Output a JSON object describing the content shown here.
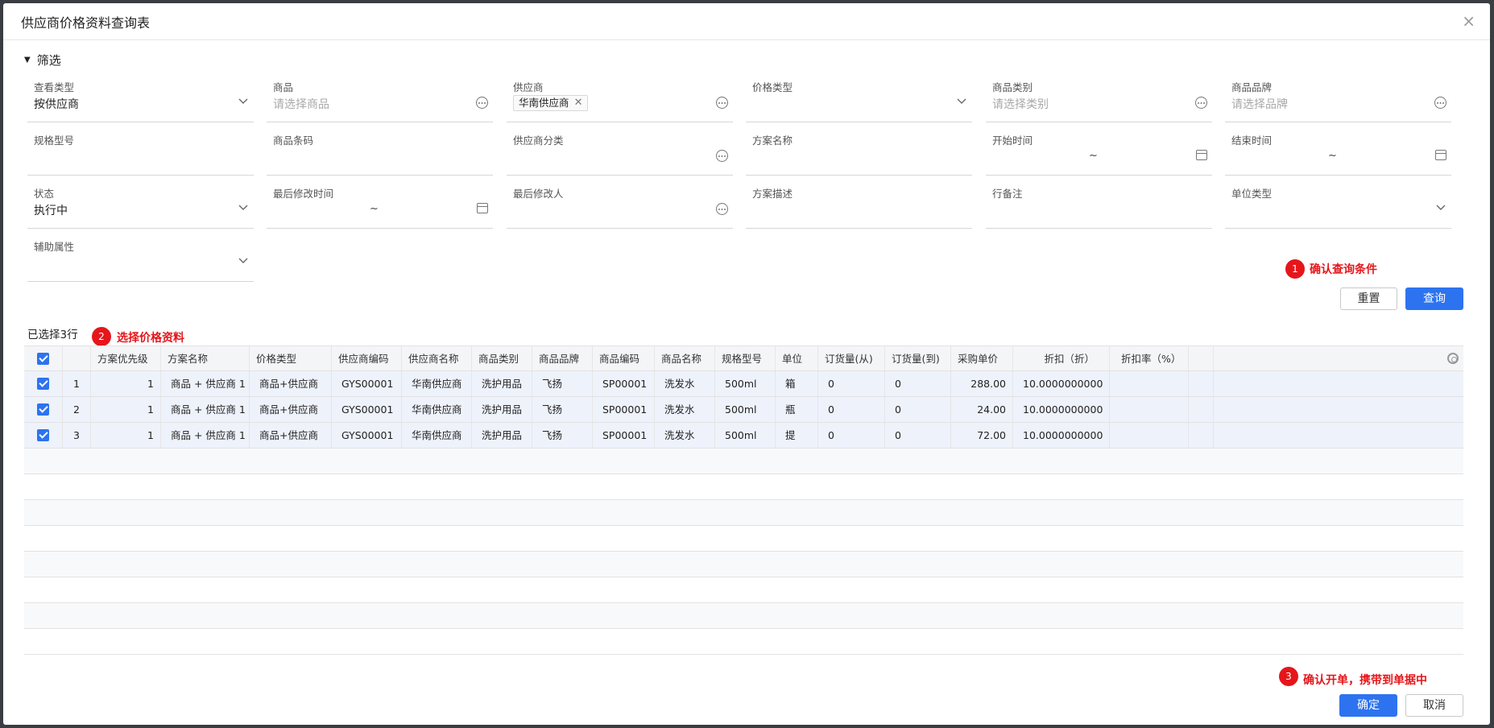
{
  "dialog": {
    "title": "供应商价格资料查询表",
    "close_glyph": "×"
  },
  "filter": {
    "header": "筛选",
    "fields": {
      "view_type": {
        "label": "查看类型",
        "value": "按供应商"
      },
      "product": {
        "label": "商品",
        "placeholder": "请选择商品"
      },
      "supplier": {
        "label": "供应商",
        "tag": "华南供应商"
      },
      "price_type": {
        "label": "价格类型"
      },
      "product_category": {
        "label": "商品类别",
        "placeholder": "请选择类别"
      },
      "product_brand": {
        "label": "商品品牌",
        "placeholder": "请选择品牌"
      },
      "spec": {
        "label": "规格型号"
      },
      "barcode": {
        "label": "商品条码"
      },
      "supplier_category": {
        "label": "供应商分类"
      },
      "plan_name": {
        "label": "方案名称"
      },
      "start_time": {
        "label": "开始时间",
        "sep": "~"
      },
      "end_time": {
        "label": "结束时间",
        "sep": "~"
      },
      "status": {
        "label": "状态",
        "value": "执行中"
      },
      "last_modified_time": {
        "label": "最后修改时间",
        "sep": "~"
      },
      "last_modifier": {
        "label": "最后修改人"
      },
      "plan_desc": {
        "label": "方案描述"
      },
      "row_note": {
        "label": "行备注"
      },
      "unit_type": {
        "label": "单位类型"
      },
      "aux_attr": {
        "label": "辅助属性"
      }
    }
  },
  "annotations": {
    "step1": {
      "num": "1",
      "text": "确认查询条件"
    },
    "step2": {
      "num": "2",
      "text": "选择价格资料"
    },
    "step3": {
      "num": "3",
      "text": "确认开单，携带到单据中"
    }
  },
  "buttons": {
    "reset": "重置",
    "query": "查询",
    "confirm": "确定",
    "cancel": "取消"
  },
  "selection": {
    "count_text": "已选择3行"
  },
  "table": {
    "columns": [
      "方案优先级",
      "方案名称",
      "价格类型",
      "供应商编码",
      "供应商名称",
      "商品类别",
      "商品品牌",
      "商品编码",
      "商品名称",
      "规格型号",
      "单位",
      "订货量(从)",
      "订货量(到)",
      "采购单价",
      "折扣（折）",
      "折扣率（%）"
    ],
    "rows": [
      {
        "no": "1",
        "cells": [
          "1",
          "商品 + 供应商 1",
          "商品+供应商",
          "GYS00001",
          "华南供应商",
          "洗护用品",
          "飞扬",
          "SP00001",
          "洗发水",
          "500ml",
          "箱",
          "0",
          "0",
          "288.00",
          "10.0000000000",
          ""
        ]
      },
      {
        "no": "2",
        "cells": [
          "1",
          "商品 + 供应商 1",
          "商品+供应商",
          "GYS00001",
          "华南供应商",
          "洗护用品",
          "飞扬",
          "SP00001",
          "洗发水",
          "500ml",
          "瓶",
          "0",
          "0",
          "24.00",
          "10.0000000000",
          ""
        ]
      },
      {
        "no": "3",
        "cells": [
          "1",
          "商品 + 供应商 1",
          "商品+供应商",
          "GYS00001",
          "华南供应商",
          "洗护用品",
          "飞扬",
          "SP00001",
          "洗发水",
          "500ml",
          "提",
          "0",
          "0",
          "72.00",
          "10.0000000000",
          ""
        ]
      }
    ]
  },
  "colors": {
    "accent": "#2d73f0",
    "annotation": "#e5161b",
    "selected_row": "#eef2fb"
  },
  "icons": [
    "caret-down-icon",
    "chevron-down-icon",
    "more-dots-icon",
    "calendar-icon",
    "tag-remove-icon",
    "checkbox-checked-icon",
    "column-settings-icon",
    "close-icon"
  ]
}
